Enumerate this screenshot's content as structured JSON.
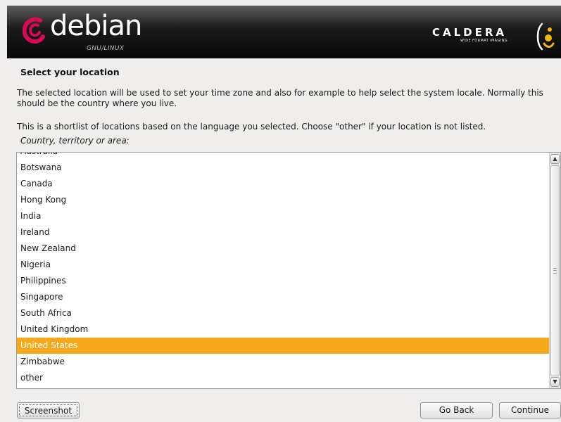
{
  "banner": {
    "left_logo": "debian",
    "left_logo_sub": "GNU/LINUX",
    "right_logo": "CALDERA",
    "right_logo_sub": "WIDE FORMAT IMAGING"
  },
  "page": {
    "title": "Select your location",
    "description": "The selected location will be used to set your time zone and also for example to help select the system locale. Normally this should be the country where you live.",
    "shortlist_note": "This is a shortlist of locations based on the language you selected. Choose \"other\" if your location is not listed.",
    "field_label": "Country, territory or area:"
  },
  "locations": {
    "items": [
      "Australia",
      "Botswana",
      "Canada",
      "Hong Kong",
      "India",
      "Ireland",
      "New Zealand",
      "Nigeria",
      "Philippines",
      "Singapore",
      "South Africa",
      "United Kingdom",
      "United States",
      "Zimbabwe",
      "other"
    ],
    "selected": "United States"
  },
  "buttons": {
    "screenshot": "Screenshot",
    "go_back": "Go Back",
    "continue": "Continue"
  },
  "colors": {
    "selection": "#f5a81a",
    "debian_red": "#d70a53",
    "caldera_accent": "#f2b705"
  }
}
